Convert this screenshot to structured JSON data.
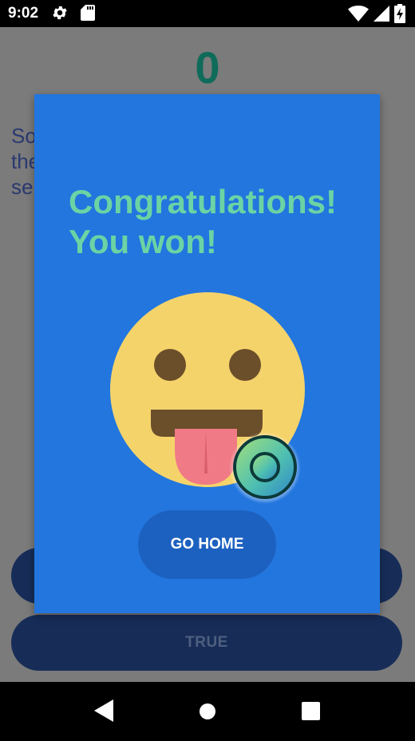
{
  "status_bar": {
    "time": "9:02",
    "icons": [
      "gear-icon",
      "sd-card-icon",
      "wifi-icon",
      "signal-icon",
      "battery-charging-icon"
    ]
  },
  "game": {
    "score": "0",
    "question": "So\nthe\nse",
    "false_label": "",
    "true_label": "TRUE"
  },
  "dialog": {
    "title": "Congratulations!\nYou won!",
    "emoji": "tongue-out-face-icon",
    "home_button": "GO HOME"
  },
  "colors": {
    "dialog_bg": "#2276de",
    "title": "#6bd3a4",
    "button": "#1d61c0",
    "emoji_face": "#f5d36b"
  },
  "nav_bar": {
    "icons": [
      "back-icon",
      "home-icon",
      "recents-icon"
    ]
  }
}
